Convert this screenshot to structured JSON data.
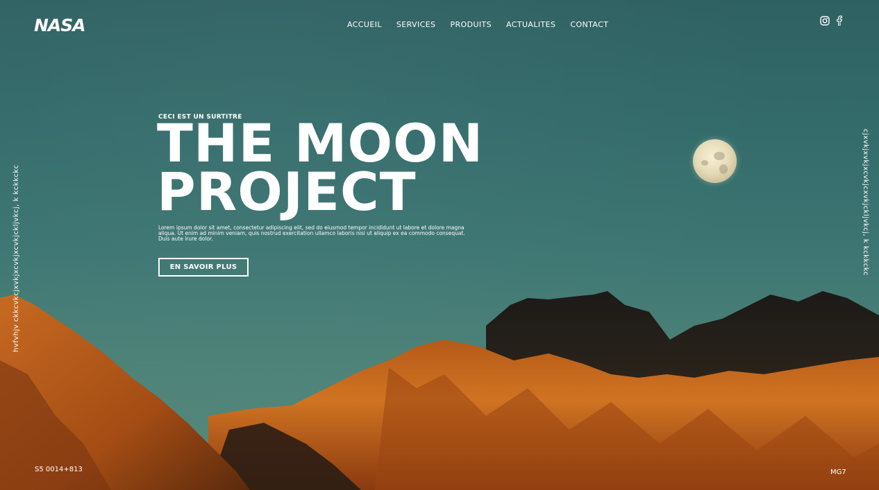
{
  "brand": {
    "logo_text": "NASA"
  },
  "nav": {
    "items": [
      {
        "label": "ACCUEIL"
      },
      {
        "label": "SERVICES"
      },
      {
        "label": "PRODUITS"
      },
      {
        "label": "ACTUALITES"
      },
      {
        "label": "CONTACT"
      }
    ]
  },
  "social": {
    "icons": [
      "instagram-icon",
      "facebook-icon"
    ]
  },
  "side": {
    "left_text": "hvfvhjv ckkcvkcjxvkjxcvkjxcvkjckljvkcj, k kckkckc",
    "right_text": "cjxvkjxvkjxcvkjcxvkjckljvkcj, k kckkckc"
  },
  "hero": {
    "surtitre": "CECI EST UN SURTITRE",
    "title_line1": "THE MOON",
    "title_line2": "PROJECT",
    "description": "Lorem ipsum dolor sit amet, consectetur adipiscing elit, sed do eiusmod tempor incididunt ut labore et dolore magna aliqua. Ut enim ad minim veniam, quis nostrud exercitation ullamco laboris nisi ut aliquip ex ea commodo consequat. Duis aute irure dolor.",
    "cta_label": "EN SAVOIR PLUS"
  },
  "footer": {
    "coords": "S5 0014+813",
    "code": "MG7"
  },
  "colors": {
    "sky_top": "#2f6162",
    "sky_bottom": "#5a8c7d",
    "mountain_lit": "#c8651c",
    "mountain_dark": "#241e18",
    "text": "#ffffff"
  }
}
